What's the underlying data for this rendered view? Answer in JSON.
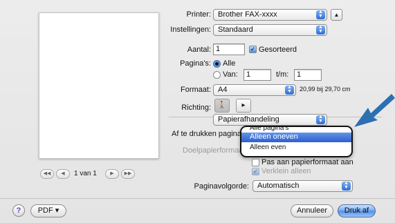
{
  "printer": {
    "label": "Printer:",
    "value": "Brother FAX-xxxx"
  },
  "presets": {
    "label": "Instellingen:",
    "value": "Standaard"
  },
  "copies": {
    "label": "Aantal:",
    "value": "1",
    "collated_label": "Gesorteerd",
    "collated": true
  },
  "pages": {
    "label": "Pagina's:",
    "all_label": "Alle",
    "from_label": "Van:",
    "from_value": "1",
    "to_label": "t/m:",
    "to_value": "1"
  },
  "paper_size": {
    "label": "Formaat:",
    "value": "A4",
    "dimensions": "20,99 bij 29,70 cm"
  },
  "orientation": {
    "label": "Richting:"
  },
  "section_popup": {
    "value": "Papierafhandeling"
  },
  "pages_to_print": {
    "label": "Af te drukken pagina's:",
    "menu_items": [
      "Alle pagina's",
      "Alleen oneven",
      "Alleen even"
    ],
    "highlighted_index": 1
  },
  "destination_paper": {
    "label": "Doelpapierformaat:"
  },
  "scale": {
    "fit_label": "Pas aan papierformaat aan",
    "reduce_label": "Verklein alleen",
    "reduce_checked": true
  },
  "page_order": {
    "label": "Paginavolgorde:",
    "value": "Automatisch"
  },
  "preview_nav": {
    "first": "◀◀",
    "prev": "◀",
    "page_text": "1 van 1",
    "next": "▶",
    "last": "▶▶"
  },
  "footer": {
    "help": "?",
    "pdf_label": "PDF ▾",
    "cancel_label": "Annuleer",
    "print_label": "Druk af"
  },
  "colors": {
    "accent": "#2d5fcf",
    "callout_arrow": "#2d6fb3"
  },
  "icons": [
    "help-icon",
    "disclosure-up-icon",
    "portrait-icon",
    "landscape-icon",
    "callout-arrow-icon"
  ]
}
